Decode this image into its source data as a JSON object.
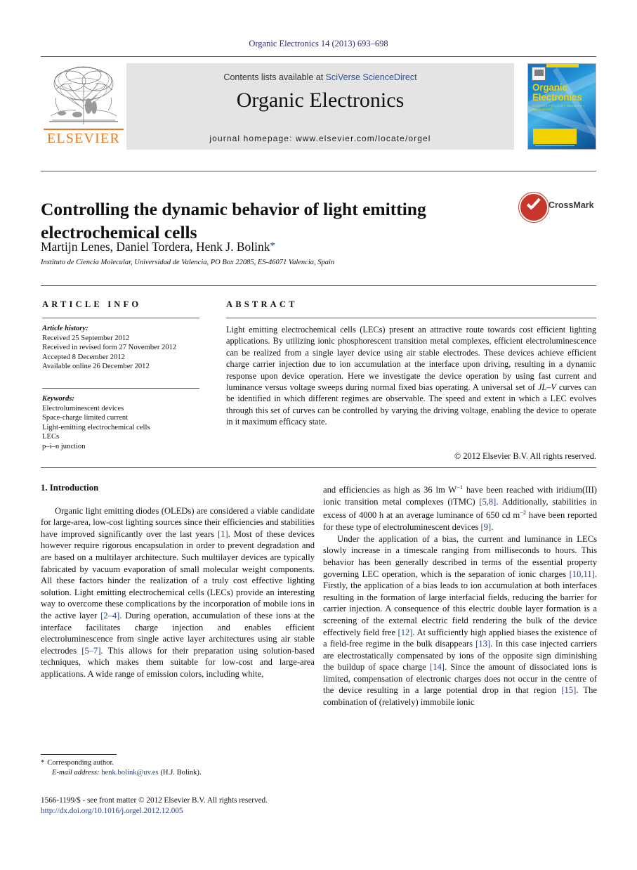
{
  "running_head": "Organic Electronics 14 (2013) 693–698",
  "masthead": {
    "elsevier_wordmark": "ELSEVIER",
    "contents_prefix": "Contents lists available at ",
    "sciencedirect_link": "SciVerse ScienceDirect",
    "journal_title": "Organic Electronics",
    "homepage": "journal homepage: www.elsevier.com/locate/orgel",
    "cover": {
      "title_line1": "Organic",
      "title_line2": "Electronics",
      "subtitle": "materials • physics • chemistry • applications"
    }
  },
  "article": {
    "title": "Controlling the dynamic behavior of light emitting electrochemical cells",
    "authors": "Martijn Lenes, Daniel Tordera, Henk J. Bolink",
    "corresponding_marker": "*",
    "affiliation": "Instituto de Ciencia Molecular, Universidad de Valencia, PO Box 22085, ES-46071 Valencia, Spain"
  },
  "crossmark": {
    "label": "CrossMark"
  },
  "info": {
    "heading": "ARTICLE INFO",
    "history_label": "Article history:",
    "history": [
      "Received 25 September 2012",
      "Received in revised form 27 November 2012",
      "Accepted 8 December 2012",
      "Available online 26 December 2012"
    ],
    "keywords_label": "Keywords:",
    "keywords": [
      "Electroluminescent devices",
      "Space-charge limited current",
      "Light-emitting electrochemical cells",
      "LECs",
      "p–i–n junction"
    ]
  },
  "abstract": {
    "heading": "ABSTRACT",
    "text_before_italic": "Light emitting electrochemical cells (LECs) present an attractive route towards cost efficient lighting applications. By utilizing ionic phosphorescent transition metal complexes, efficient electroluminescence can be realized from a single layer device using air stable electrodes. These devices achieve efficient charge carrier injection due to ion accumulation at the interface upon driving, resulting in a dynamic response upon device operation. Here we investigate the device operation by using fast current and luminance versus voltage sweeps during normal fixed bias operating. A universal set of ",
    "italic_term": "JL–V",
    "text_after_italic": " curves can be identified in which different regimes are observable. The speed and extent in which a LEC evolves through this set of curves can be controlled by varying the driving voltage, enabling the device to operate in it maximum efficacy state.",
    "copyright": "© 2012 Elsevier B.V. All rights reserved."
  },
  "body": {
    "section_heading": "1. Introduction",
    "left_paragraph_1_a": "Organic light emitting diodes (OLEDs) are considered a viable candidate for large-area, low-cost lighting sources since their efficiencies and stabilities have improved significantly over the last years ",
    "ref_1": "[1]",
    "left_paragraph_1_b": ". Most of these devices however require rigorous encapsulation in order to prevent degradation and are based on a multilayer architecture. Such multilayer devices are typically fabricated by vacuum evaporation of small molecular weight components. All these factors hinder the realization of a truly cost effective lighting solution. Light emitting electrochemical cells (LECs) provide an interesting way to overcome these complications by the incorporation of mobile ions in the active layer ",
    "ref_2_4": "[2–4]",
    "left_paragraph_1_c": ". During operation, accumulation of these ions at the interface facilitates charge injection and enables efficient electroluminescence from single active layer architectures using air stable electrodes ",
    "ref_5_7": "[5–7]",
    "left_paragraph_1_d": ". This allows for their preparation using solution-based techniques, which makes them suitable for low-cost and large-area applications. A wide range of emission colors, including white,",
    "right_paragraph_1_a": "and efficiencies as high as 36 lm W",
    "sup_minus_1": "−1",
    "right_paragraph_1_b": " have been reached with iridium(III) ionic transition metal complexes (iTMC) ",
    "ref_5_8": "[5,8]",
    "right_paragraph_1_c": ". Additionally, stabilities in excess of 4000 h at an average luminance of 650 cd m",
    "sup_minus_2": "−2",
    "right_paragraph_1_d": " have been reported for these type of electroluminescent devices ",
    "ref_9": "[9]",
    "right_paragraph_1_e": ".",
    "right_paragraph_2_a": "Under the application of a bias, the current and luminance in LECs slowly increase in a timescale ranging from milliseconds to hours. This behavior has been generally described in terms of the essential property governing LEC operation, which is the separation of ionic charges ",
    "ref_10_11": "[10,11]",
    "right_paragraph_2_b": ". Firstly, the application of a bias leads to ion accumulation at both interfaces resulting in the formation of large interfacial fields, reducing the barrier for carrier injection. A consequence of this electric double layer formation is a screening of the external electric field rendering the bulk of the device effectively field free ",
    "ref_12": "[12]",
    "right_paragraph_2_c": ". At sufficiently high applied biases the existence of a field-free regime in the bulk disappears ",
    "ref_13": "[13]",
    "right_paragraph_2_d": ". In this case injected carriers are electrostatically compensated by ions of the opposite sign diminishing the buildup of space charge ",
    "ref_14": "[14]",
    "right_paragraph_2_e": ". Since the amount of dissociated ions is limited, compensation of electronic charges does not occur in the centre of the device resulting in a large potential drop in that region ",
    "ref_15": "[15]",
    "right_paragraph_2_f": ". The combination of (relatively) immobile ionic"
  },
  "footnotes": {
    "corresponding_star": "*",
    "corresponding_text": "Corresponding author.",
    "email_label": "E-mail address:",
    "email": "henk.bolink@uv.es",
    "email_owner": "(H.J. Bolink)."
  },
  "imprint": {
    "line1": "1566-1199/$ - see front matter © 2012 Elsevier B.V. All rights reserved.",
    "doi": "http://dx.doi.org/10.1016/j.orgel.2012.12.005"
  },
  "colors": {
    "link_blue": "#27408b",
    "sciencedirect_blue": "#2b4fa2",
    "elsevier_orange": "#e87722",
    "crossmark_red": "#c8372d",
    "banner_grey": "#e4e4e4"
  }
}
